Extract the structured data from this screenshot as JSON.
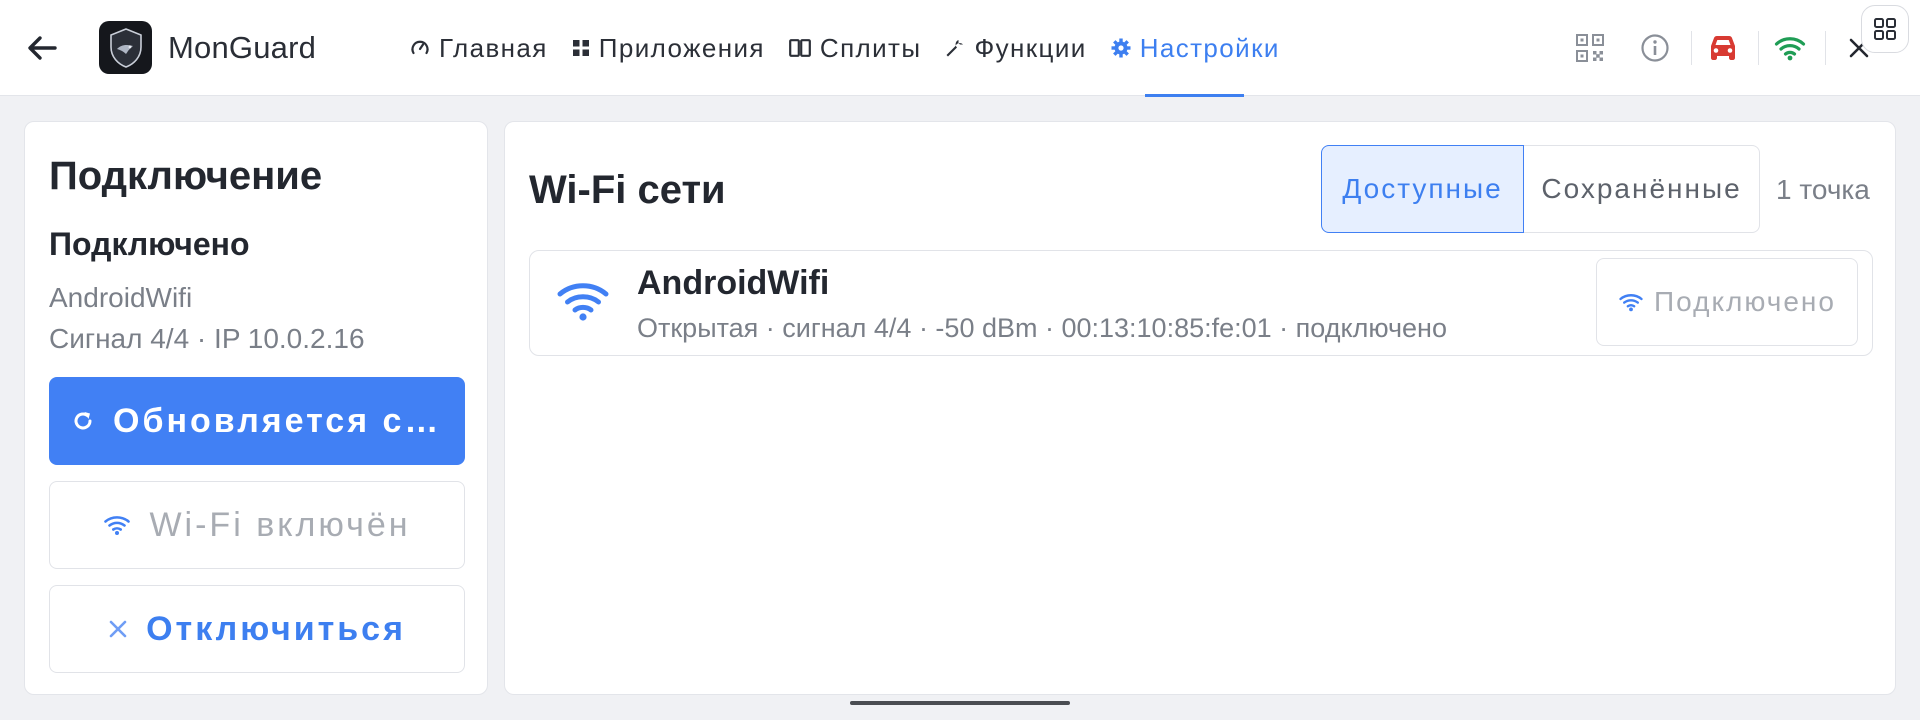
{
  "app": {
    "title": "MonGuard",
    "logo_icon": "shield-logo-icon"
  },
  "header": {
    "back_icon": "arrow-left-icon",
    "tabs": [
      {
        "label": "Главная",
        "icon": "speedometer-icon",
        "active": false
      },
      {
        "label": "Приложения",
        "icon": "grid-icon",
        "active": false
      },
      {
        "label": "Сплиты",
        "icon": "split-icon",
        "active": false
      },
      {
        "label": "Функции",
        "icon": "wrench-icon",
        "active": false
      },
      {
        "label": "Настройки",
        "icon": "gear-icon",
        "active": true
      }
    ],
    "actions": [
      "qr-code-icon",
      "info-icon",
      "car-icon",
      "wifi-icon",
      "close-icon"
    ],
    "floating_button_icon": "apps-grid-icon"
  },
  "connection": {
    "title": "Подключение",
    "status": "Подключено",
    "ssid": "AndroidWifi",
    "signal_line": "Сигнал 4/4 · IP 10.0.2.16",
    "refresh_button": "Обновляется сигнал",
    "wifi_button": "Wi-Fi включён",
    "disconnect_button": "Отключиться"
  },
  "networks": {
    "title": "Wi-Fi сети",
    "segments": {
      "available": "Доступные",
      "saved": "Сохранённые",
      "selected": "available"
    },
    "count_label": "1 точка",
    "items": [
      {
        "name": "AndroidWifi",
        "details": "Открытая · сигнал 4/4 · -50 dBm · 00:13:10:85:fe:01 · подключено",
        "button_label": "Подключено"
      }
    ]
  },
  "colors": {
    "accent": "#4180f4",
    "car_icon": "#d83a32",
    "wifi_status": "#1f9d55"
  }
}
